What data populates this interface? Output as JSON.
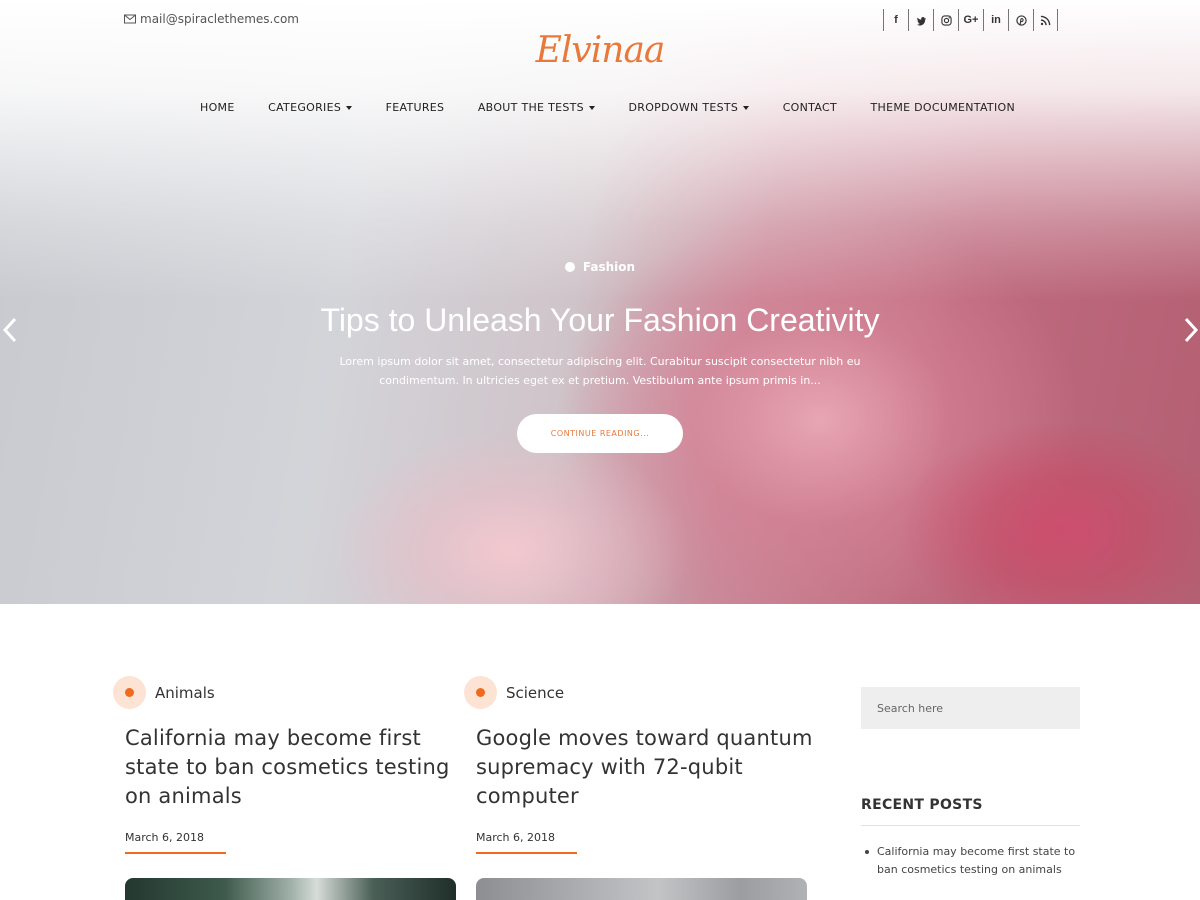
{
  "topbar": {
    "email": "mail@spiraclethemes.com",
    "social": [
      {
        "icon": "facebook-icon",
        "glyph": "f"
      },
      {
        "icon": "twitter-icon",
        "glyph": ""
      },
      {
        "icon": "instagram-icon",
        "glyph": ""
      },
      {
        "icon": "google-plus-icon",
        "glyph": "G+"
      },
      {
        "icon": "linkedin-icon",
        "glyph": "in"
      },
      {
        "icon": "pinterest-icon",
        "glyph": ""
      },
      {
        "icon": "rss-icon",
        "glyph": ""
      }
    ]
  },
  "site": {
    "logo": "Elvinaa",
    "accent": "#e8793a",
    "highlight": "#f06a1d"
  },
  "nav": {
    "items": [
      {
        "label": "HOME",
        "dropdown": false
      },
      {
        "label": "CATEGORIES",
        "dropdown": true
      },
      {
        "label": "FEATURES",
        "dropdown": false
      },
      {
        "label": "ABOUT THE TESTS",
        "dropdown": true
      },
      {
        "label": "DROPDOWN TESTS",
        "dropdown": true
      },
      {
        "label": "CONTACT",
        "dropdown": false
      },
      {
        "label": "THEME DOCUMENTATION",
        "dropdown": false
      }
    ]
  },
  "slider": {
    "category": "Fashion",
    "title": "Tips to Unleash Your Fashion Creativity",
    "excerpt": "Lorem ipsum dolor sit amet, consectetur adipiscing elit. Curabitur suscipit consectetur nibh eu condimentum. In ultricies eget ex et pretium. Vestibulum ante ipsum primis in...",
    "button": "CONTINUE READING..."
  },
  "posts": [
    {
      "category": "Animals",
      "title": "California may become first state to ban cosmetics testing on animals",
      "date": "March 6, 2018"
    },
    {
      "category": "Science",
      "title": "Google moves toward quantum supremacy with 72-qubit computer",
      "date": "March 6, 2018"
    }
  ],
  "sidebar": {
    "search_placeholder": "Search here",
    "recent_title": "RECENT POSTS",
    "recent": [
      "California may become first state to ban cosmetics testing on animals"
    ]
  }
}
